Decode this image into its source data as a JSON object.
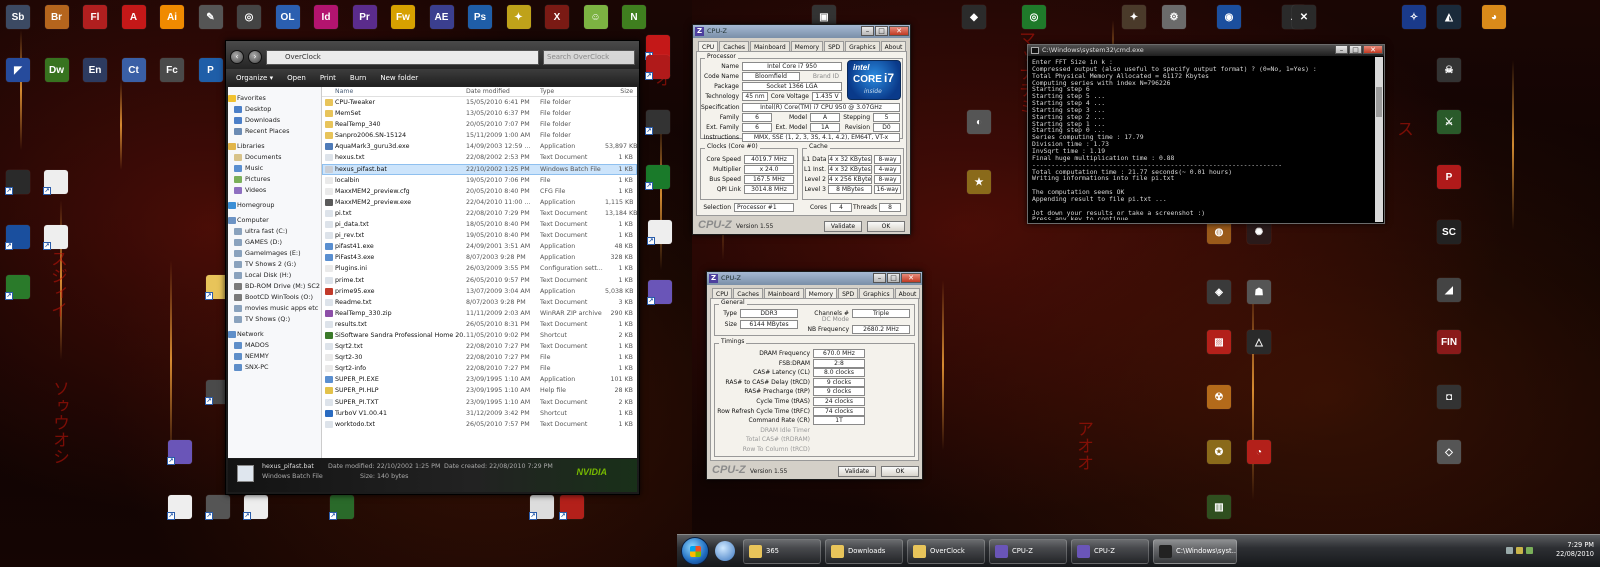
{
  "explorer": {
    "address": "OverClock",
    "search_placeholder": "Search OverClock",
    "toolbar": [
      "Organize ▾",
      "Open",
      "Print",
      "Burn",
      "New folder"
    ],
    "columns": [
      "Name",
      "Date modified",
      "Type",
      "Size"
    ],
    "sidebar": [
      {
        "label": "Favorites",
        "group": true,
        "color": "#f2c230"
      },
      {
        "label": "Desktop",
        "group": false,
        "color": "#4b7fc8"
      },
      {
        "label": "Downloads",
        "group": false,
        "color": "#4b7fc8"
      },
      {
        "label": "Recent Places",
        "group": false,
        "color": "#6b8bb3"
      },
      {
        "label": "Libraries",
        "group": true,
        "color": "#e1b54a"
      },
      {
        "label": "Documents",
        "group": false,
        "color": "#d8c38a"
      },
      {
        "label": "Music",
        "group": false,
        "color": "#5a8fd0"
      },
      {
        "label": "Pictures",
        "group": false,
        "color": "#7ab05a"
      },
      {
        "label": "Videos",
        "group": false,
        "color": "#8e6fc0"
      },
      {
        "label": "Homegroup",
        "group": true,
        "color": "#3b8fd6"
      },
      {
        "label": "Computer",
        "group": true,
        "color": "#6c93c4"
      },
      {
        "label": "ultra fast (C:)",
        "group": false,
        "color": "#8aa2bd"
      },
      {
        "label": "GAMES (D:)",
        "group": false,
        "color": "#8aa2bd"
      },
      {
        "label": "GameImages (E:)",
        "group": false,
        "color": "#8aa2bd"
      },
      {
        "label": "TV Shows 2 (G:)",
        "group": false,
        "color": "#8aa2bd"
      },
      {
        "label": "Local Disk (H:)",
        "group": false,
        "color": "#8aa2bd"
      },
      {
        "label": "BD-ROM Drive (M:) SC2",
        "group": false,
        "color": "#7a7a7a"
      },
      {
        "label": "BootCD WinTools (O:)",
        "group": false,
        "color": "#7a7a7a"
      },
      {
        "label": "movies music apps etc",
        "group": false,
        "color": "#8aa2bd"
      },
      {
        "label": "TV Shows (Q:)",
        "group": false,
        "color": "#8aa2bd"
      },
      {
        "label": "Network",
        "group": true,
        "color": "#5e8ec9"
      },
      {
        "label": "MADOS",
        "group": false,
        "color": "#5e8ec9"
      },
      {
        "label": "NEMMY",
        "group": false,
        "color": "#5e8ec9"
      },
      {
        "label": "SNX-PC",
        "group": false,
        "color": "#5e8ec9"
      }
    ],
    "files": [
      {
        "name": "CPU-Tweaker",
        "date": "15/05/2010 6:41 PM",
        "type": "File folder",
        "size": "",
        "color": "#e8c45a"
      },
      {
        "name": "MemSet",
        "date": "13/05/2010 6:37 PM",
        "type": "File folder",
        "size": "",
        "color": "#e8c45a"
      },
      {
        "name": "RealTemp_340",
        "date": "20/05/2010 7:07 PM",
        "type": "File folder",
        "size": "",
        "color": "#e8c45a"
      },
      {
        "name": "Sanpro2006.SN-15124",
        "date": "15/11/2009 1:00 AM",
        "type": "File folder",
        "size": "",
        "color": "#e8c45a"
      },
      {
        "name": "AquaMark3_guru3d.exe",
        "date": "14/09/2003 12:59 ...",
        "type": "Application",
        "size": "53,897 KB",
        "color": "#4f7bb8"
      },
      {
        "name": "hexus.txt",
        "date": "22/08/2002 2:53 PM",
        "type": "Text Document",
        "size": "1 KB",
        "color": "#dde3ea"
      },
      {
        "name": "hexus_pifast.bat",
        "date": "22/10/2002 1:25 PM",
        "type": "Windows Batch File",
        "size": "1 KB",
        "color": "#c9ced6",
        "selected": true
      },
      {
        "name": "localbin",
        "date": "19/05/2010 7:06 PM",
        "type": "File",
        "size": "1 KB",
        "color": "#eaeaea"
      },
      {
        "name": "MaxxMEM2_preview.cfg",
        "date": "20/05/2010 8:40 PM",
        "type": "CFG File",
        "size": "1 KB",
        "color": "#eaeaea"
      },
      {
        "name": "MaxxMEM2_preview.exe",
        "date": "22/04/2010 11:00 ...",
        "type": "Application",
        "size": "1,115 KB",
        "color": "#5a5a5a"
      },
      {
        "name": "pi.txt",
        "date": "22/08/2010 7:29 PM",
        "type": "Text Document",
        "size": "13,184 KB",
        "color": "#dde3ea"
      },
      {
        "name": "pi_data.txt",
        "date": "18/05/2010 8:40 PM",
        "type": "Text Document",
        "size": "1 KB",
        "color": "#dde3ea"
      },
      {
        "name": "pi_rev.txt",
        "date": "19/05/2010 8:40 PM",
        "type": "Text Document",
        "size": "1 KB",
        "color": "#dde3ea"
      },
      {
        "name": "pifast41.exe",
        "date": "24/09/2001 3:51 AM",
        "type": "Application",
        "size": "48 KB",
        "color": "#5a8fd0"
      },
      {
        "name": "PiFast43.exe",
        "date": "8/07/2003 9:28 PM",
        "type": "Application",
        "size": "328 KB",
        "color": "#5a8fd0"
      },
      {
        "name": "Plugins.ini",
        "date": "26/03/2009 3:55 PM",
        "type": "Configuration sett...",
        "size": "1 KB",
        "color": "#eaeaea"
      },
      {
        "name": "prime.txt",
        "date": "26/05/2010 9:57 PM",
        "type": "Text Document",
        "size": "1 KB",
        "color": "#dde3ea"
      },
      {
        "name": "prime95.exe",
        "date": "13/07/2009 3:04 AM",
        "type": "Application",
        "size": "5,038 KB",
        "color": "#c23a2a"
      },
      {
        "name": "Readme.txt",
        "date": "8/07/2003 9:28 PM",
        "type": "Text Document",
        "size": "3 KB",
        "color": "#dde3ea"
      },
      {
        "name": "RealTemp_330.zip",
        "date": "11/11/2009 2:03 AM",
        "type": "WinRAR ZIP archive",
        "size": "290 KB",
        "color": "#8d4fa8"
      },
      {
        "name": "results.txt",
        "date": "26/05/2010 8:31 PM",
        "type": "Text Document",
        "size": "1 KB",
        "color": "#dde3ea"
      },
      {
        "name": "SiSoftware Sandra Professional Home 20...",
        "date": "11/05/2010 9:02 PM",
        "type": "Shortcut",
        "size": "2 KB",
        "color": "#3b7a2a"
      },
      {
        "name": "Sqrt2.txt",
        "date": "22/08/2010 7:27 PM",
        "type": "Text Document",
        "size": "1 KB",
        "color": "#dde3ea"
      },
      {
        "name": "Sqrt2-30",
        "date": "22/08/2010 7:27 PM",
        "type": "File",
        "size": "1 KB",
        "color": "#eaeaea"
      },
      {
        "name": "Sqrt2-info",
        "date": "22/08/2010 7:27 PM",
        "type": "File",
        "size": "1 KB",
        "color": "#eaeaea"
      },
      {
        "name": "SUPER_PI.EXE",
        "date": "23/09/1995 1:10 AM",
        "type": "Application",
        "size": "101 KB",
        "color": "#5a8fd0"
      },
      {
        "name": "SUPER_PI.HLP",
        "date": "23/09/1995 1:10 AM",
        "type": "Help file",
        "size": "28 KB",
        "color": "#e3c24a"
      },
      {
        "name": "SUPER_PI.TXT",
        "date": "23/09/1995 1:10 AM",
        "type": "Text Document",
        "size": "2 KB",
        "color": "#dde3ea"
      },
      {
        "name": "TurboV V1.00.41",
        "date": "31/12/2009 3:42 PM",
        "type": "Shortcut",
        "size": "1 KB",
        "color": "#2a6bc0"
      },
      {
        "name": "worktodo.txt",
        "date": "26/05/2010 7:57 PM",
        "type": "Text Document",
        "size": "1 KB",
        "color": "#dde3ea"
      }
    ],
    "details": {
      "filename": "hexus_pifast.bat",
      "filetype": "Windows Batch File",
      "modified": "Date modified: 22/10/2002 1:25 PM",
      "created": "Date created: 22/08/2010 7:29 PM",
      "size": "Size: 140 bytes",
      "brand": "NVIDIA"
    }
  },
  "cpuz_cpu": {
    "title": "CPU-Z",
    "tabs": [
      "CPU",
      "Caches",
      "Mainboard",
      "Memory",
      "SPD",
      "Graphics",
      "About"
    ],
    "active_tab": "CPU",
    "processor_group": "Processor",
    "name_label": "Name",
    "name": "Intel Core i7 950",
    "codename_label": "Code Name",
    "codename": "Bloomfield",
    "brand_id": "Brand ID",
    "package_label": "Package",
    "package": "Socket 1366 LGA",
    "technology_label": "Technology",
    "technology": "45 nm",
    "corevoltage_label": "Core Voltage",
    "corevoltage": "1.435 V",
    "spec_label": "Specification",
    "spec": "Intel(R) Core(TM) i7 CPU     950  @ 3.07GHz",
    "family_label": "Family",
    "family": "6",
    "model_label": "Model",
    "model": "A",
    "stepping_label": "Stepping",
    "stepping": "5",
    "extfamily_label": "Ext. Family",
    "extfamily": "6",
    "extmodel_label": "Ext. Model",
    "extmodel": "1A",
    "revision_label": "Revision",
    "revision": "D0",
    "instructions_label": "Instructions",
    "instructions": "MMX, SSE (1, 2, 3, 3S, 4.1, 4.2), EM64T, VT-x",
    "clocks_group": "Clocks (Core #0)",
    "corespeed_label": "Core Speed",
    "corespeed": "4019.7 MHz",
    "multiplier_label": "Multiplier",
    "multiplier": "x 24.0",
    "busspeed_label": "Bus Speed",
    "busspeed": "167.5 MHz",
    "qpi_label": "QPI Link",
    "qpi": "3014.8 MHz",
    "cache_group": "Cache",
    "l1d_label": "L1 Data",
    "l1d": "4 x 32 KBytes",
    "l1d_way": "8-way",
    "l1i_label": "L1 Inst.",
    "l1i": "4 x 32 KBytes",
    "l1i_way": "4-way",
    "l2_label": "Level 2",
    "l2": "4 x 256 KBytes",
    "l2_way": "8-way",
    "l3_label": "Level 3",
    "l3": "8 MBytes",
    "l3_way": "16-way",
    "selection_label": "Selection",
    "selection": "Processor #1",
    "cores_label": "Cores",
    "cores": "4",
    "threads_label": "Threads",
    "threads": "8",
    "version": "Version 1.55",
    "validate": "Validate",
    "ok": "OK",
    "intel_text": "intel",
    "core_text": "CORE",
    "i7_text": "i7",
    "inside_text": "inside"
  },
  "cpuz_mem": {
    "title": "CPU-Z",
    "tabs": [
      "CPU",
      "Caches",
      "Mainboard",
      "Memory",
      "SPD",
      "Graphics",
      "About"
    ],
    "active_tab": "Memory",
    "general_group": "General",
    "type_label": "Type",
    "type": "DDR3",
    "size_label": "Size",
    "size": "6144 MBytes",
    "channels_label": "Channels #",
    "channels": "Triple",
    "dcmode_label": "DC Mode",
    "nbfreq_label": "NB Frequency",
    "nbfreq": "2680.2 MHz",
    "timings_group": "Timings",
    "timings": [
      {
        "label": "DRAM Frequency",
        "value": "670.0 MHz"
      },
      {
        "label": "FSB:DRAM",
        "value": "2:8"
      },
      {
        "label": "CAS# Latency (CL)",
        "value": "8.0 clocks"
      },
      {
        "label": "RAS# to CAS# Delay (tRCD)",
        "value": "9 clocks"
      },
      {
        "label": "RAS# Precharge (tRP)",
        "value": "9 clocks"
      },
      {
        "label": "Cycle Time (tRAS)",
        "value": "24 clocks"
      },
      {
        "label": "Row Refresh Cycle Time (tRFC)",
        "value": "74 clocks"
      },
      {
        "label": "Command Rate (CR)",
        "value": "1T"
      },
      {
        "label": "DRAM Idle Timer",
        "value": ""
      },
      {
        "label": "Total CAS# (tRDRAM)",
        "value": ""
      },
      {
        "label": "Row To Column (tRCD)",
        "value": ""
      }
    ],
    "version": "Version 1.55",
    "validate": "Validate",
    "ok": "OK"
  },
  "cmd": {
    "title": "C:\\Windows\\system32\\cmd.exe",
    "lines": [
      "Enter FFT Size in k :",
      "Compressed output (also useful to specify output format) ? (0=No, 1=Yes) :",
      "Total Physical Memory Allocated = 61172 Kbytes",
      "Computing series with index N=796226",
      "Starting step 6",
      "Starting step 5 ...",
      "Starting step 4 ...",
      "Starting step 3 ...",
      "Starting step 2 ...",
      "Starting step 1 ...",
      "Starting step 0 ...",
      "Series computing time : 17.79",
      "Division time : 1.73",
      "InvSqrt time : 1.19",
      "Final huge multiplication time : 0.88",
      "-----------------------------------------------------------------",
      "Total computation time : 21.77 seconds(~ 0.01 hours)",
      "Writing informations into file pi.txt",
      "",
      "The computation seems OK",
      "Appending result to file pi.txt ...",
      "",
      "Jot down your results or take a screenshot :)",
      "Press any key to continue . . ."
    ]
  },
  "taskbar": {
    "buttons": [
      {
        "label": "365",
        "color": "#e8c45a"
      },
      {
        "label": "Downloads",
        "color": "#e8c45a"
      },
      {
        "label": "OverClock",
        "color": "#e8c45a"
      },
      {
        "label": "CPU-Z",
        "color": "#6a55b8"
      },
      {
        "label": "CPU-Z",
        "color": "#6a55b8"
      },
      {
        "label": "C:\\Windows\\syst...",
        "color": "#222222",
        "active": true
      }
    ],
    "time": "7:29 PM",
    "date": "22/08/2010"
  },
  "desktop_icons_left": [
    {
      "name": "soundbooth-icon",
      "text": "Sb",
      "color": "#3c4a63"
    },
    {
      "name": "bridge-icon",
      "text": "Br",
      "color": "#b5651d"
    },
    {
      "name": "flash-icon",
      "text": "Fl",
      "color": "#b01f1f"
    },
    {
      "name": "acrobat-icon",
      "text": "A",
      "color": "#c41818"
    },
    {
      "name": "illustrator-icon",
      "text": "Ai",
      "color": "#f08a00"
    },
    {
      "name": "tool-icon",
      "text": "✎",
      "color": "#555555"
    },
    {
      "name": "app-icon",
      "text": "◎",
      "color": "#444444"
    },
    {
      "name": "onlocation-icon",
      "text": "OL",
      "color": "#2b5fb0"
    },
    {
      "name": "indesign-icon",
      "text": "Id",
      "color": "#b3146f"
    },
    {
      "name": "premiere-icon",
      "text": "Pr",
      "color": "#5b2c8c"
    },
    {
      "name": "fireworks-icon",
      "text": "Fw",
      "color": "#d7a100"
    },
    {
      "name": "aftereffects-icon",
      "text": "AE",
      "color": "#3b3f8f"
    },
    {
      "name": "photoshop-icon",
      "text": "Ps",
      "color": "#1f5ea8"
    },
    {
      "name": "game-icon",
      "text": "✦",
      "color": "#bfa21a"
    },
    {
      "name": "xbox-icon",
      "text": "X",
      "color": "#7a1a14"
    },
    {
      "name": "msn-icon",
      "text": "☺",
      "color": "#7cb342"
    },
    {
      "name": "nvidia-icon",
      "text": "N",
      "color": "#3f7f1f"
    }
  ],
  "desktop_icons_left2": [
    {
      "name": "visualstudio-icon",
      "text": "◤",
      "color": "#264b9c"
    },
    {
      "name": "dreamweaver-icon",
      "text": "Dw",
      "color": "#37731f"
    },
    {
      "name": "encore-icon",
      "text": "En",
      "color": "#2d3b60"
    },
    {
      "name": "contribute-icon",
      "text": "Ct",
      "color": "#3a5fa6"
    },
    {
      "name": "flashcatalyst-icon",
      "text": "Fc",
      "color": "#4a4a4a"
    },
    {
      "name": "pdf-icon",
      "text": "P",
      "color": "#1f5ea8"
    }
  ]
}
